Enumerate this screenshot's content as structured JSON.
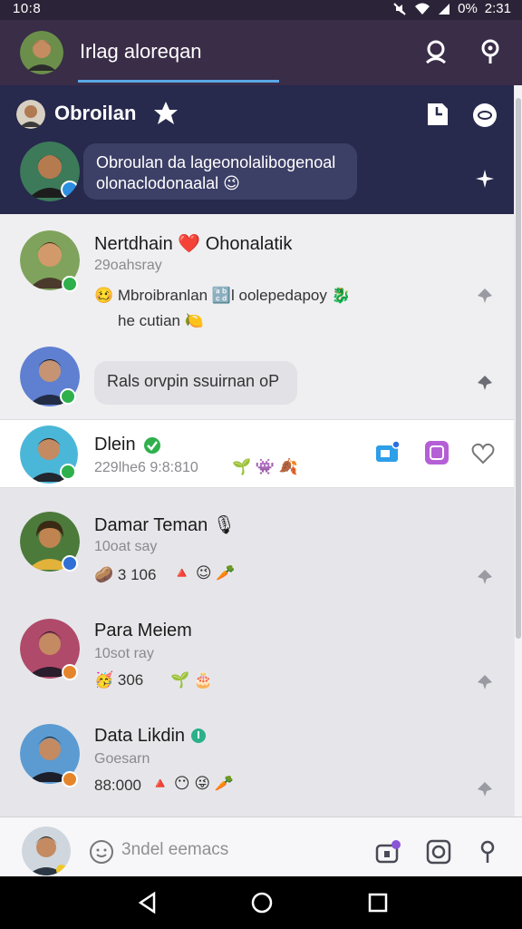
{
  "status": {
    "time": "10:8",
    "battery": "0%",
    "clock": "2:31"
  },
  "header": {
    "title": "Irlag aloreqan"
  },
  "banner": {
    "name": "Obroilan",
    "message_line1": "Obroulan da lageonolalibogenoal",
    "message_line2": "olonaclodonaalal 😉"
  },
  "chats": [
    {
      "name": "Nertdhain ❤️ Ohonalatik",
      "sub": "29oahsray",
      "msg1": "🥴 Mbroibranlan 🔡l oolepedapoy 🐉",
      "msg2": "he cutian 🍋",
      "accent": "#2fb04c"
    },
    {
      "name": "",
      "bubble": "Rals orvpin ssuirnan oP",
      "accent": "#2fb04c"
    },
    {
      "name": "Dlein",
      "sub": "229lhe6 9:8:810",
      "msg1": "🌱 👾 🍂",
      "accent": "#2fb04c"
    },
    {
      "name": "Damar Teman 🎙",
      "sub": "10oat say",
      "msg1": "🥔 3 106",
      "emojis": "🔺 😉 🥕",
      "accent": "#2f6fd6"
    },
    {
      "name": "Para Meiem",
      "sub": "10sot ray",
      "msg1": "🥳 306",
      "emojis": "🌱 🎂",
      "accent": "#e5852b"
    },
    {
      "name": "Data Likdin",
      "sub": "Goesarn",
      "msg1": "88:000",
      "emojis": "🔺 😶 😜 🥕",
      "accent": "#e5852b"
    }
  ],
  "composer": {
    "placeholder": "3ndel eemacs"
  }
}
